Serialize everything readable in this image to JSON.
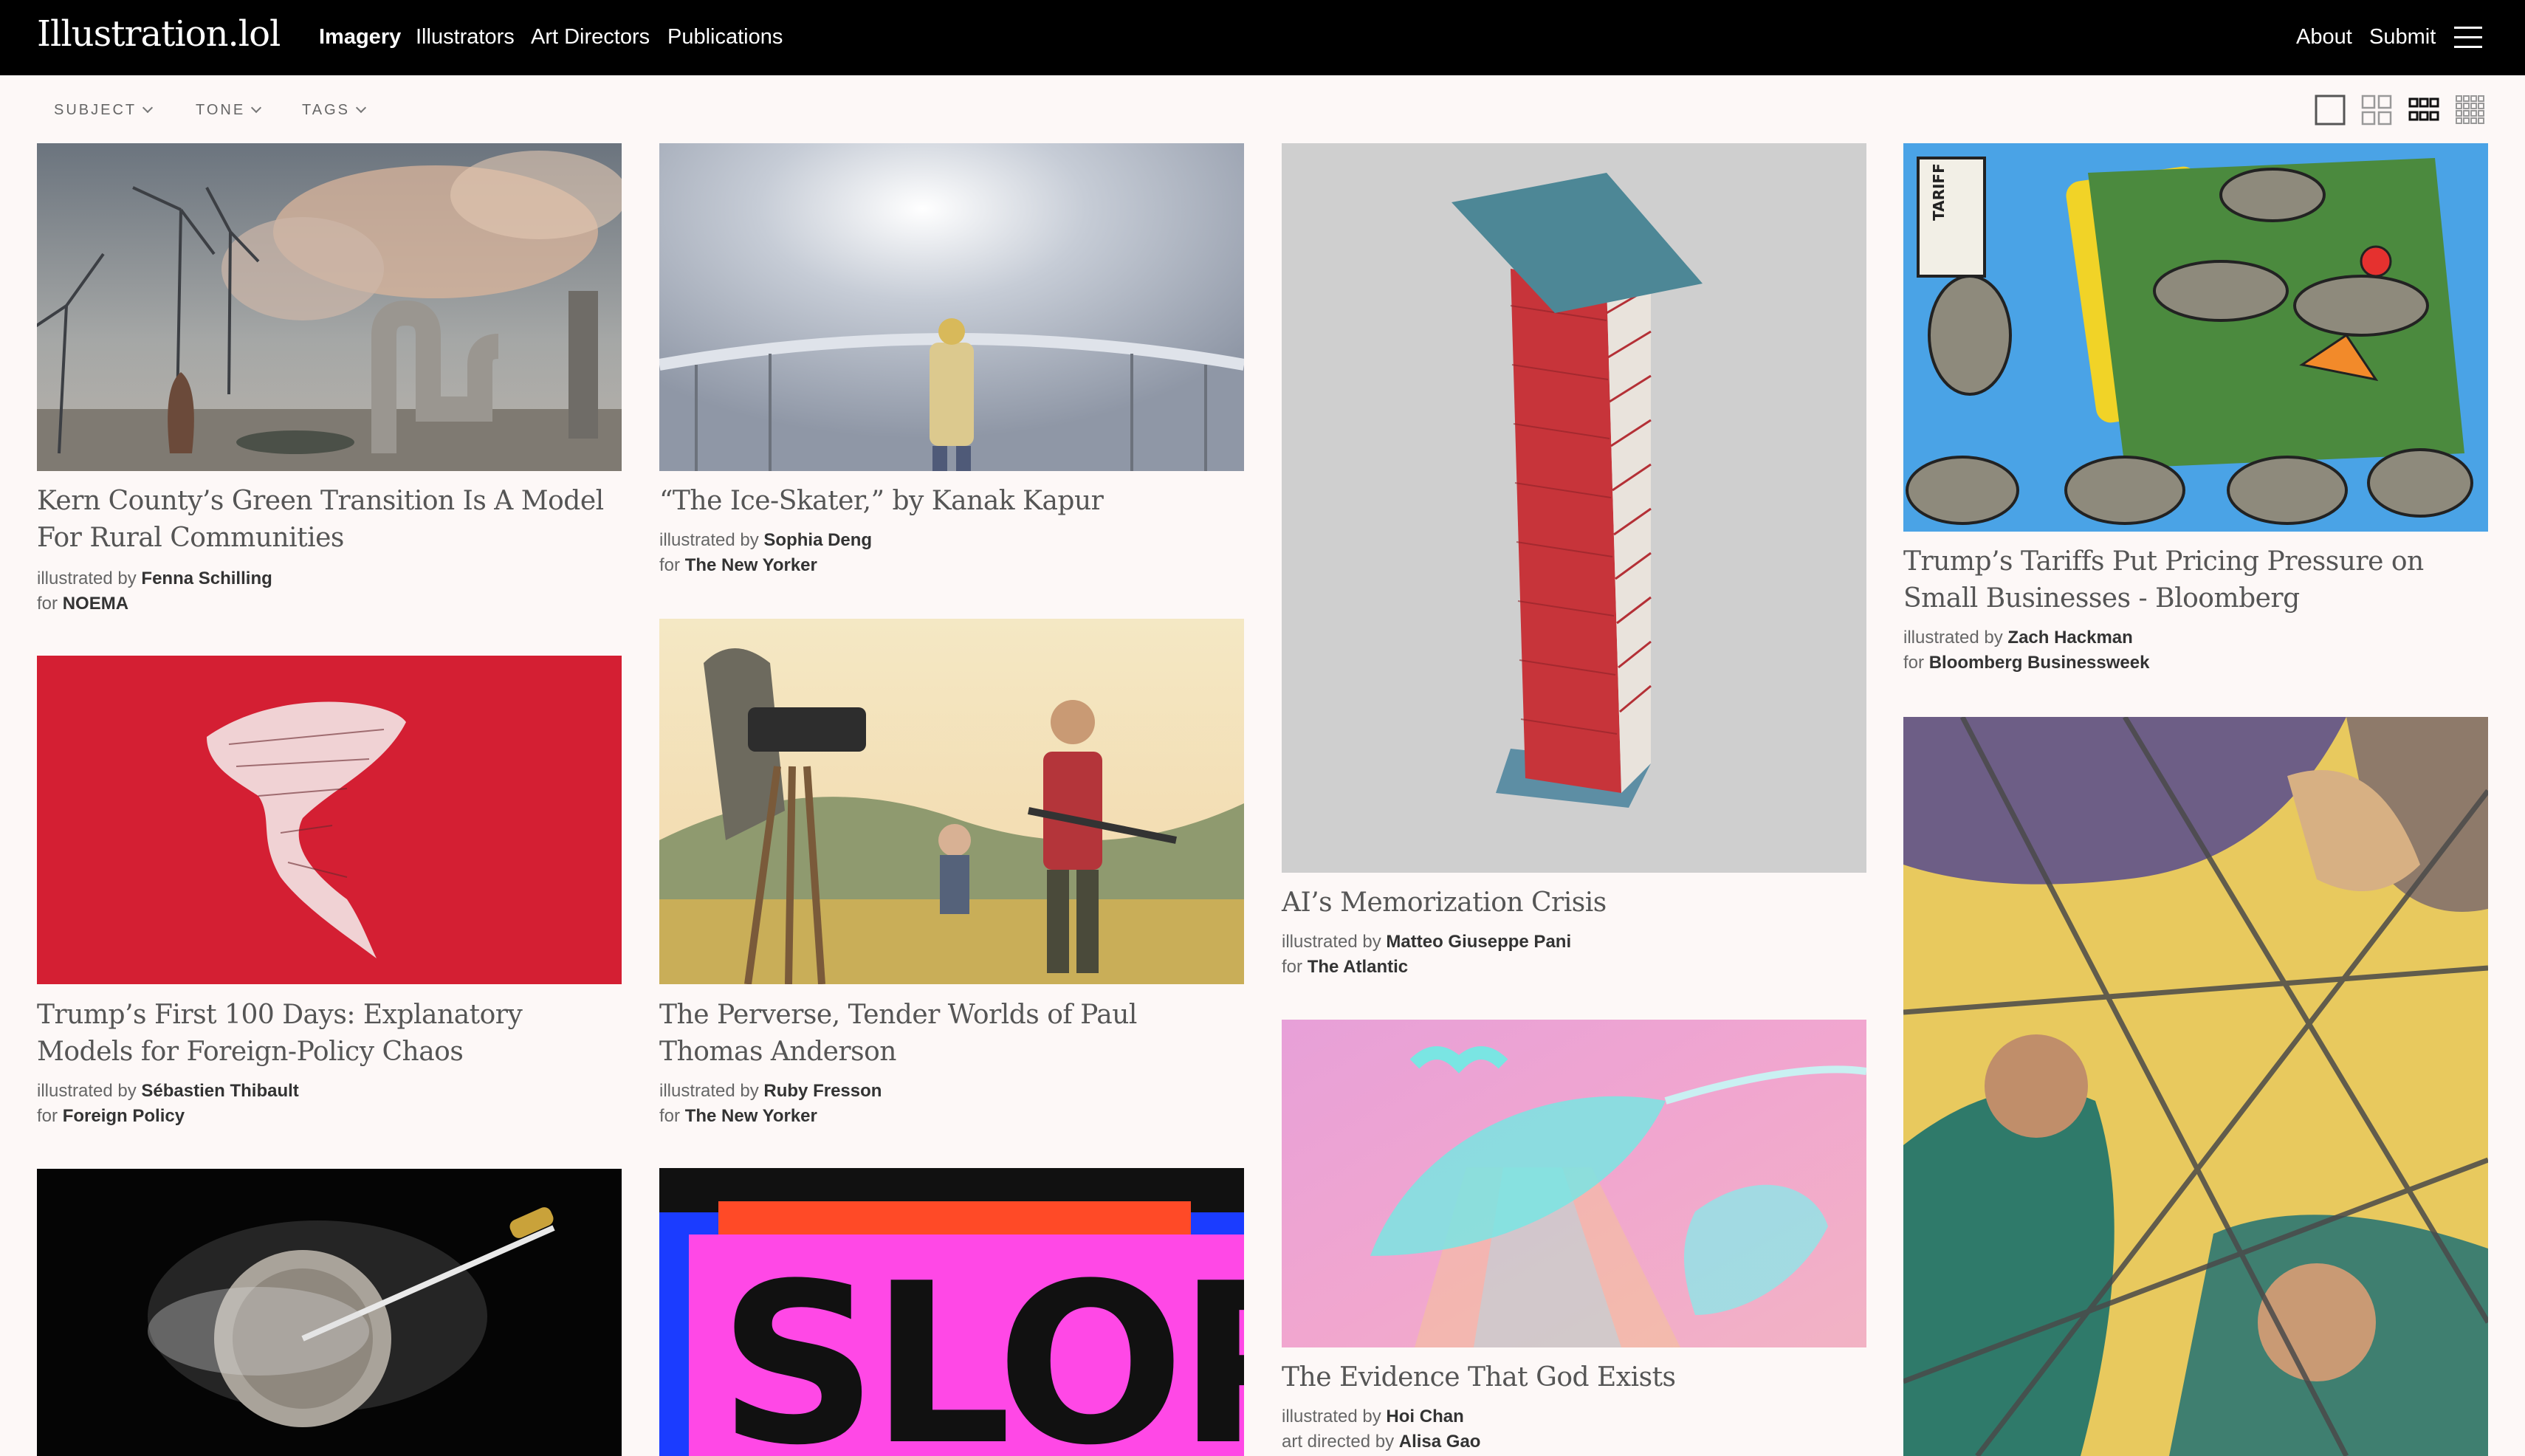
{
  "app": {
    "logo": "Illustration.lol"
  },
  "nav": {
    "imagery": "Imagery",
    "illustrators": "Illustrators",
    "art_directors": "Art Directors",
    "publications": "Publications",
    "about": "About",
    "submit": "Submit"
  },
  "filters": {
    "subject": "SUBJECT",
    "tone": "TONE",
    "tags": "TAGS"
  },
  "cards": [
    {
      "title": "Kern County’s Green Transition Is A Model For Rural Communities",
      "by_label": "illustrated by",
      "by": "Fenna Schilling",
      "for_label": "for",
      "pub": "NOEMA"
    },
    {
      "title": "Trump’s First 100 Days: Explanatory Models for Foreign-Policy Chaos",
      "by_label": "illustrated by",
      "by": "Sébastien Thibault",
      "for_label": "for",
      "pub": "Foreign Policy"
    },
    {
      "title": "“The Ice-Skater,” by Kanak Kapur",
      "by_label": "illustrated by",
      "by": "Sophia Deng",
      "for_label": "for",
      "pub": "The New Yorker"
    },
    {
      "title": "The Perverse, Tender Worlds of Paul Thomas Anderson",
      "by_label": "illustrated by",
      "by": "Ruby Fresson",
      "for_label": "for",
      "pub": "The New Yorker"
    },
    {
      "title": "AI’s Memorization Crisis",
      "by_label": "illustrated by",
      "by": "Matteo Giuseppe Pani",
      "for_label": "for",
      "pub": "The Atlantic"
    },
    {
      "title": "The Evidence That God Exists",
      "by_label": "illustrated by",
      "by": "Hoi Chan",
      "for_label": "art directed by",
      "pub": "Alisa Gao"
    },
    {
      "title": "Trump’s Tariffs Put Pricing Pressure on Small Businesses - Bloomberg",
      "by_label": "illustrated by",
      "by": "Zach Hackman",
      "for_label": "for",
      "pub": "Bloomberg Businessweek"
    }
  ],
  "slop_text": "SLOP",
  "tariff_sign": "TARIFF"
}
